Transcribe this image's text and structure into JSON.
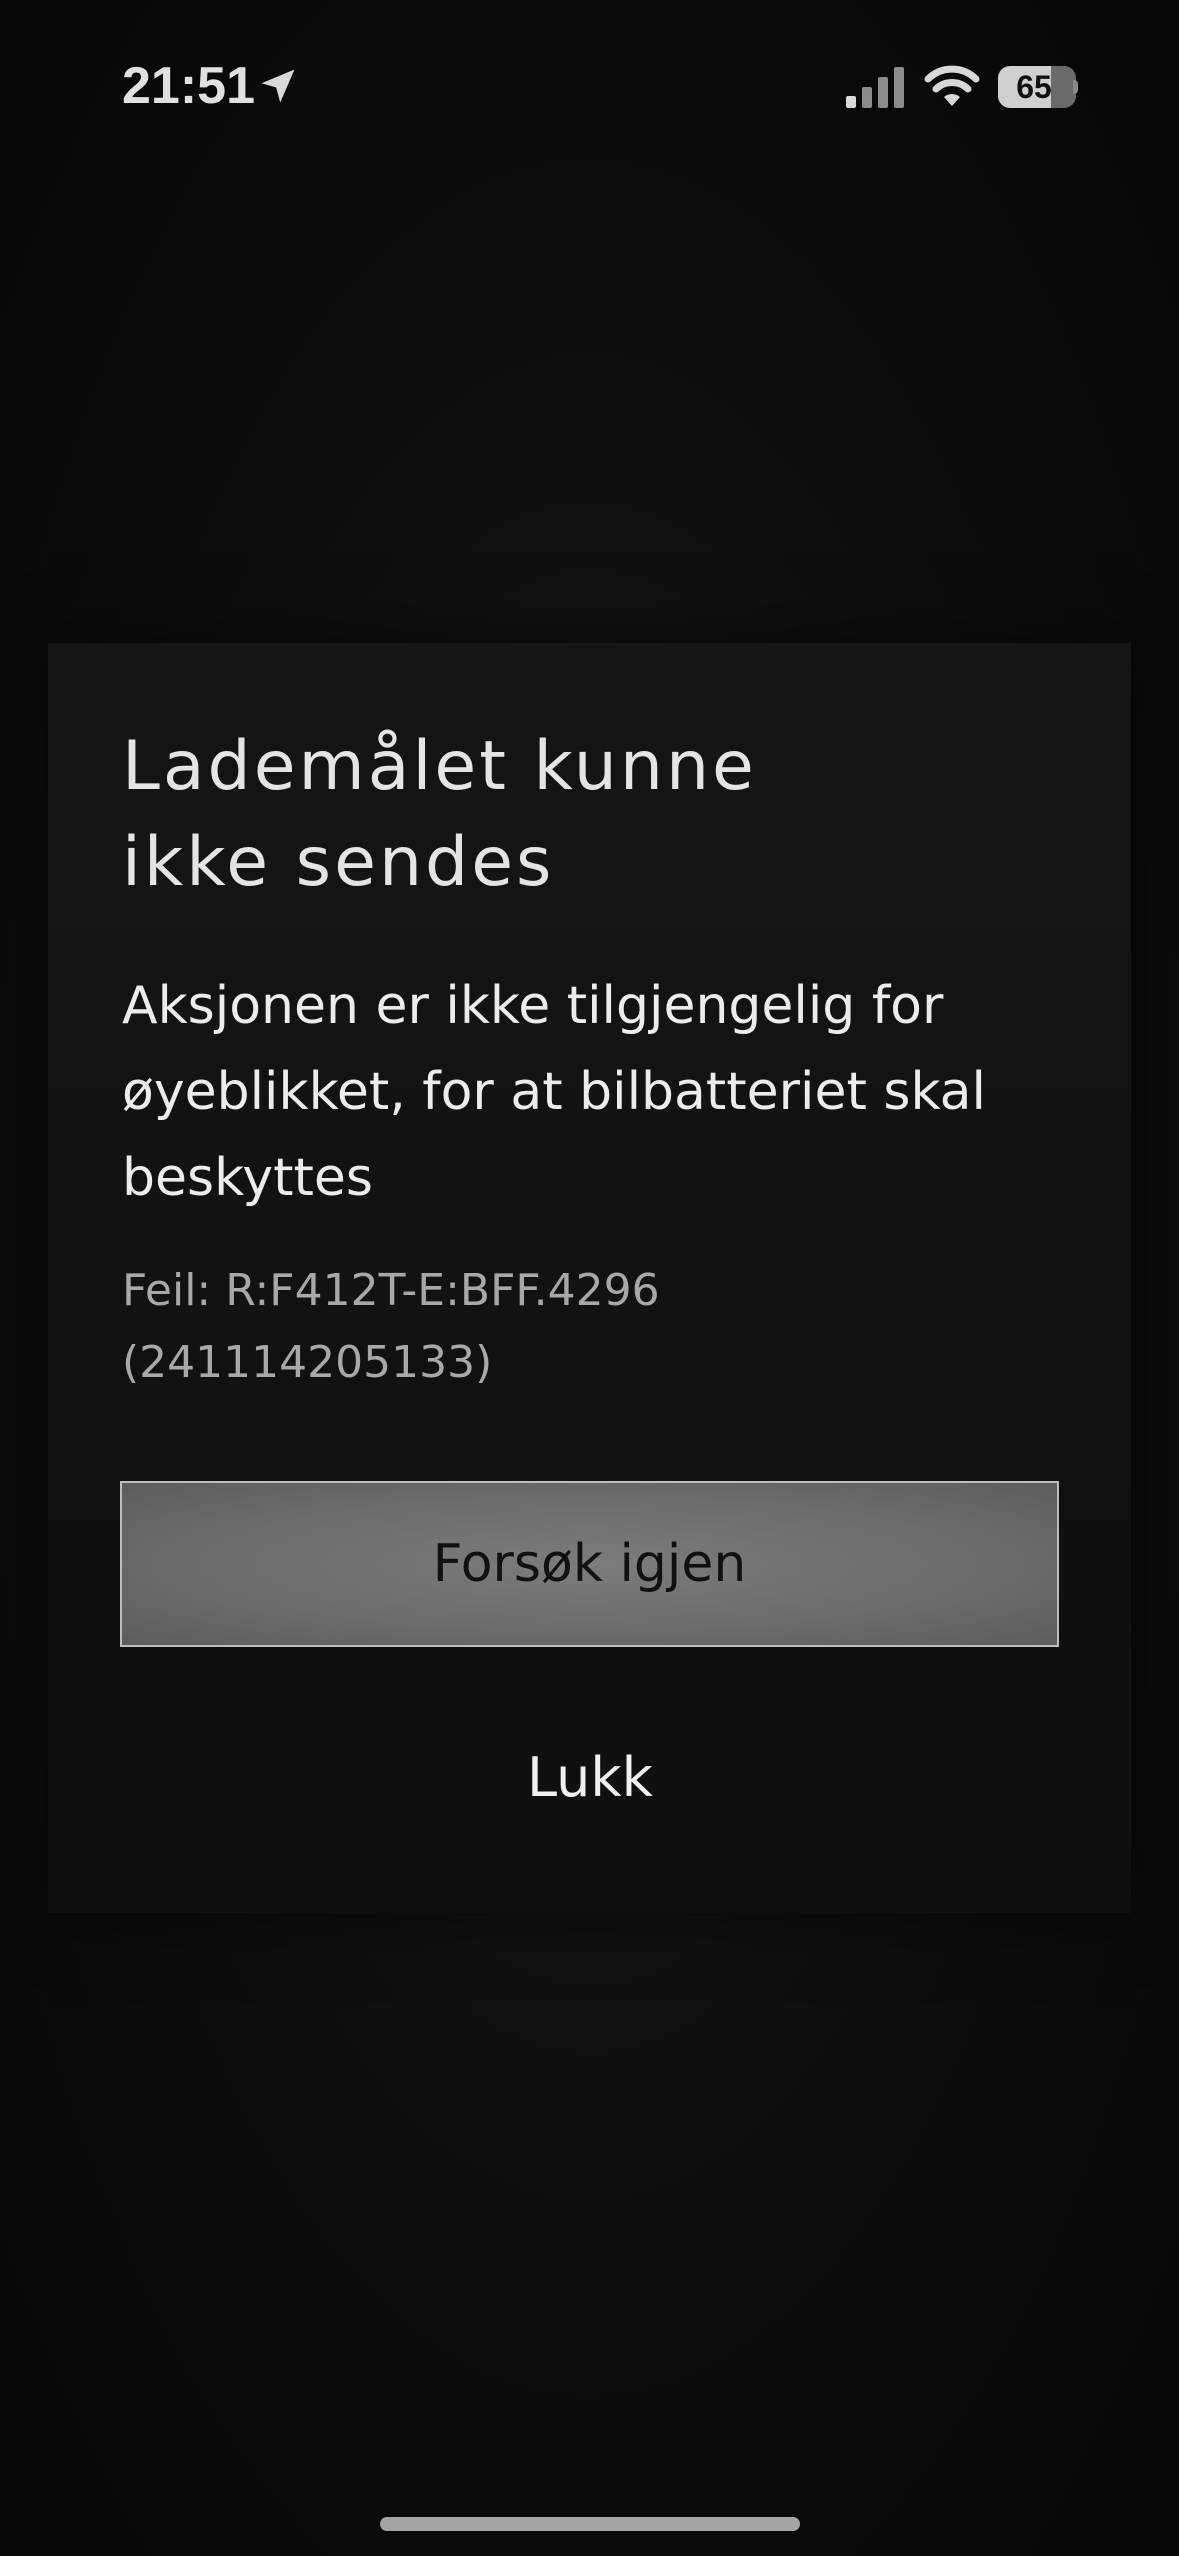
{
  "status_bar": {
    "time": "21:51",
    "battery_level": "65",
    "battery_percent": 65,
    "icons": [
      "location-arrow-icon",
      "cellular-signal-icon",
      "wifi-icon",
      "battery-icon"
    ]
  },
  "dialog": {
    "title_line1": "Lademålet kunne",
    "title_line2": "ikke sendes",
    "message": "Aksjonen er ikke tilgjengelig for øyeblikket, for at bilbatteriet skal beskyttes",
    "error_code": "Feil: R:F412T-E:BFF.4296",
    "error_id": "(241114205133)",
    "retry_label": "Forsøk igjen",
    "close_label": "Lukk"
  },
  "colors": {
    "background": "#0a0a0a",
    "dialog_background": "#131313",
    "button_fill": "#6f6f6f",
    "button_border": "#bdbdbd",
    "error_text": "#a8a8a8"
  }
}
